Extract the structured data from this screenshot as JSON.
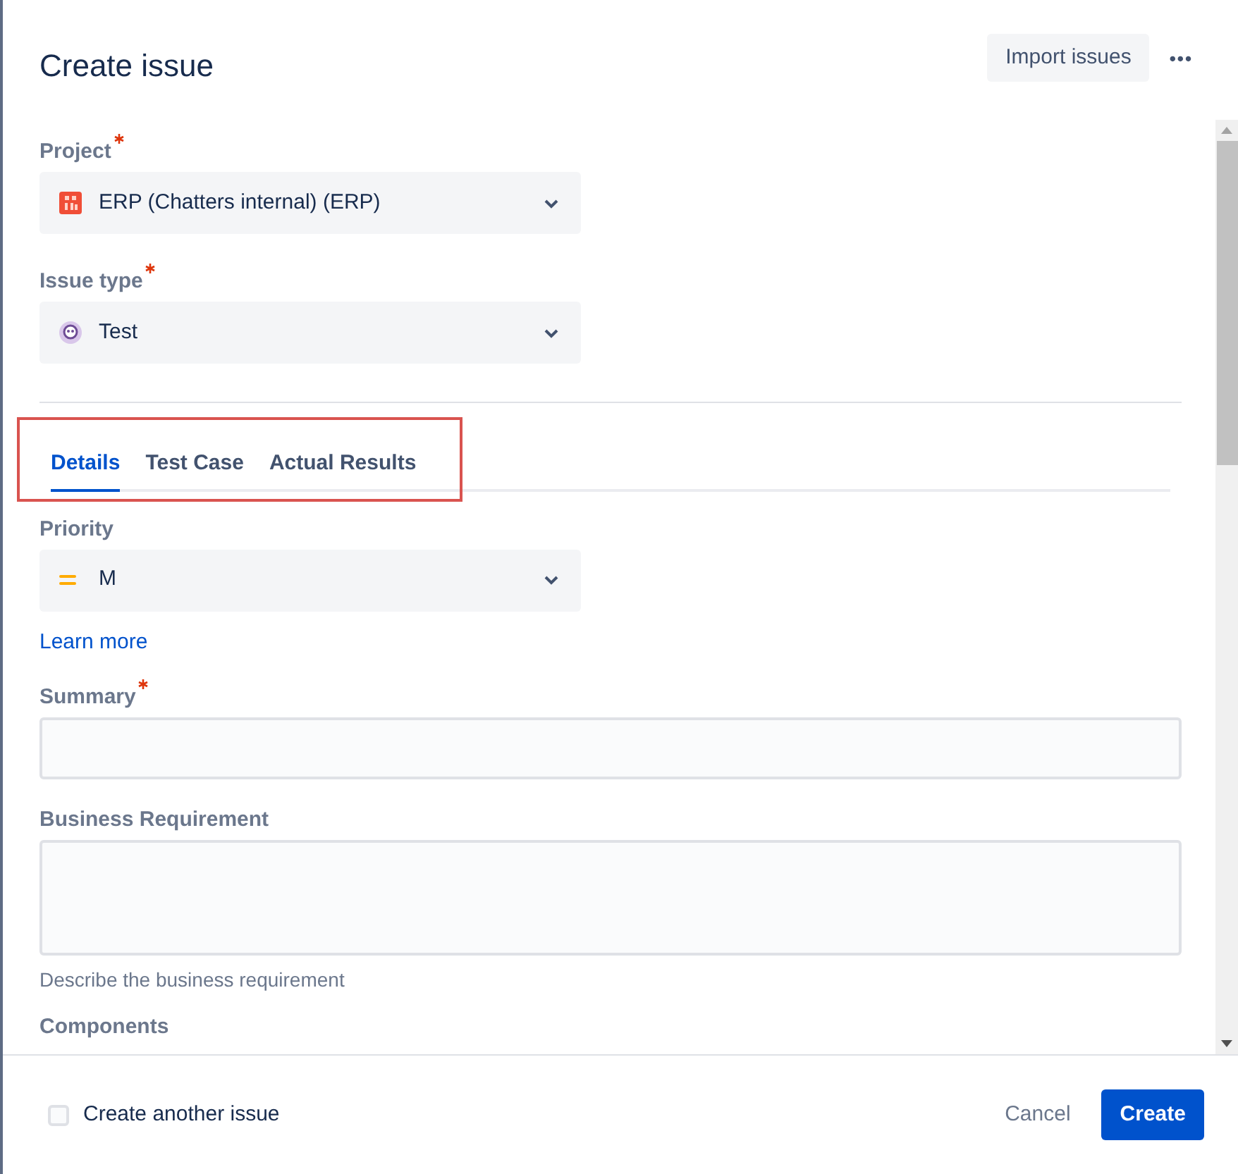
{
  "title": "Create issue",
  "header_actions": {
    "import_button": "Import issues",
    "more_button": "•••"
  },
  "selects": [
    {
      "label": "Project",
      "required": true,
      "value": "ERP (Chatters internal) (ERP)",
      "kind": "project"
    },
    {
      "label": "Issue type",
      "required": true,
      "value": "Test",
      "kind": "issuetype"
    }
  ],
  "tabs": [
    {
      "label": "Details",
      "selected": true
    },
    {
      "label": "Test Case",
      "selected": false
    },
    {
      "label": "Actual Results",
      "selected": false
    }
  ],
  "priority": {
    "label": "Priority",
    "value": "M",
    "link": "Learn more"
  },
  "summary": {
    "label": "Summary",
    "required": true
  },
  "business_requirement": {
    "label": "Business Requirement",
    "help": "Describe the business requirement"
  },
  "components": {
    "label": "Components"
  },
  "footer": {
    "create_another": {
      "label": "Create another issue",
      "checked": false
    },
    "cancel": "Cancel",
    "create": "Create"
  }
}
